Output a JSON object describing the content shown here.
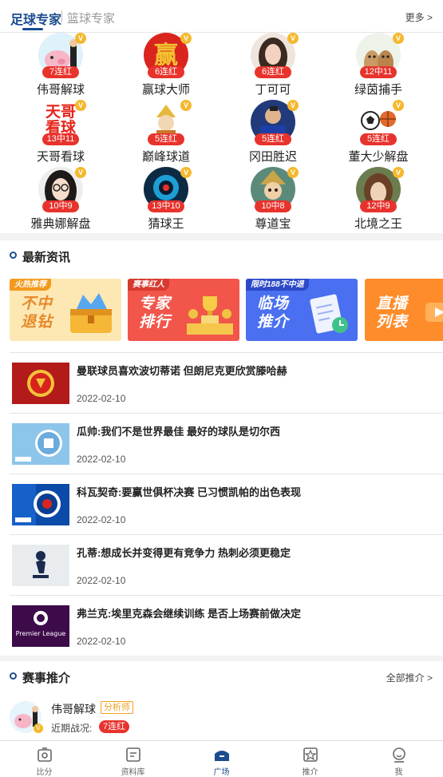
{
  "tabs": {
    "football": "足球专家",
    "basketball": "篮球专家",
    "more": "更多 >"
  },
  "experts": [
    {
      "name": "伟哥解球",
      "streak": "7连红",
      "avatar": "pig-avatar"
    },
    {
      "name": "赢球大师",
      "streak": "6连红",
      "avatar": "win-char-avatar"
    },
    {
      "name": "丁可可",
      "streak": "6连红",
      "avatar": "woman-avatar"
    },
    {
      "name": "绿茵捕手",
      "streak": "12中11",
      "avatar": "dogs-avatar"
    },
    {
      "name": "天哥看球",
      "streak": "13中11",
      "avatar": "text-avatar",
      "avatar_text": "天哥看球"
    },
    {
      "name": "巅峰球道",
      "streak": "5连红",
      "avatar": "monk-avatar"
    },
    {
      "name": "冈田胜迟",
      "streak": "5连红",
      "avatar": "player-avatar"
    },
    {
      "name": "董大少解盘",
      "streak": "5连红",
      "avatar": "balls-avatar"
    },
    {
      "name": "雅典娜解盘",
      "streak": "10中9",
      "avatar": "glasses-woman-avatar"
    },
    {
      "name": "猜球王",
      "streak": "13中10",
      "avatar": "robot-avatar"
    },
    {
      "name": "尊道宝",
      "streak": "10中8",
      "avatar": "warrior-avatar"
    },
    {
      "name": "北境之王",
      "streak": "12中9",
      "avatar": "child-avatar"
    }
  ],
  "news_section": {
    "title": "最新资讯",
    "banners": [
      {
        "tag": "火热推荐",
        "title": "不中退钻",
        "bg": "#fde8b4",
        "tag_bg": "#f39a1e",
        "color": "#e8892a"
      },
      {
        "tag": "赛事红人",
        "title": "专家排行",
        "bg": "#f2554a",
        "tag_bg": "#d63a30",
        "color": "#ffffff"
      },
      {
        "tag": "限时188不中退",
        "title": "临场推介",
        "bg": "#4a6ff0",
        "tag_bg": "#2c49c8",
        "color": "#ffffff"
      },
      {
        "tag": "",
        "title": "直播列表",
        "bg": "#ff8c2a",
        "tag_bg": "#ff8c2a",
        "color": "#ffffff"
      }
    ],
    "items": [
      {
        "title": "曼联球员喜欢波切蒂诺 但朗尼克更欣赏滕哈赫",
        "date": "2022-02-10",
        "thumb": "manutd-logo-icon"
      },
      {
        "title": "瓜帅:我们不是世界最佳 最好的球队是切尔西",
        "date": "2022-02-10",
        "thumb": "mancity-logo-icon"
      },
      {
        "title": "科瓦契奇:要赢世俱杯决赛 已习惯凯帕的出色表现",
        "date": "2022-02-10",
        "thumb": "chelsea-logo-icon"
      },
      {
        "title": "孔蒂:想成长并变得更有竞争力 热刺必须更稳定",
        "date": "2022-02-10",
        "thumb": "spurs-logo-icon"
      },
      {
        "title": "弗兰克:埃里克森会继续训练 是否上场赛前做决定",
        "date": "2022-02-10",
        "thumb": "premier-league-logo-icon"
      }
    ]
  },
  "match_section": {
    "title": "赛事推介",
    "more": "全部推介 >",
    "expert_name": "伟哥解球",
    "role": "分析师",
    "recent_label": "近期战况:",
    "streak": "7连红"
  },
  "bottom_nav": [
    {
      "label": "比分",
      "icon": "score-icon"
    },
    {
      "label": "资料库",
      "icon": "database-icon"
    },
    {
      "label": "广场",
      "icon": "plaza-icon",
      "active": true
    },
    {
      "label": "推介",
      "icon": "recommend-icon"
    },
    {
      "label": "我",
      "icon": "profile-icon"
    }
  ],
  "colors": {
    "accent": "#1b4c8f",
    "streak_red": "#e8332c",
    "badge_gold": "#f5b82e"
  }
}
